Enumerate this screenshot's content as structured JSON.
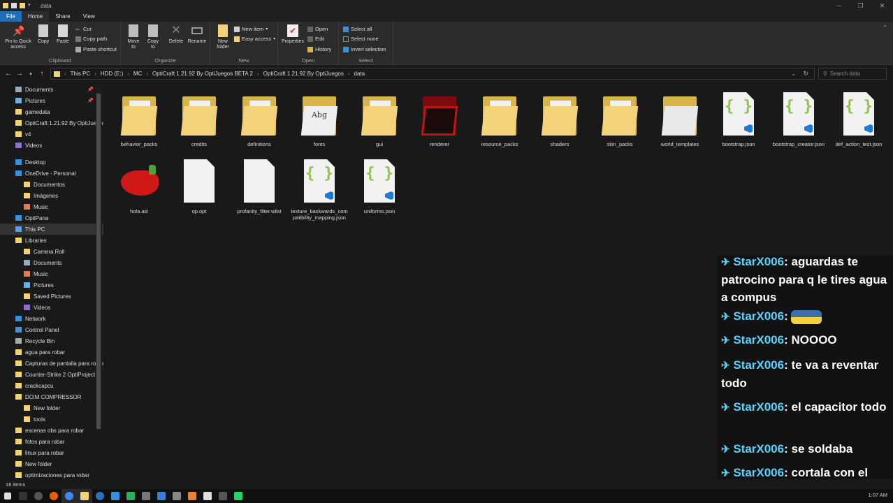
{
  "window": {
    "title": "data"
  },
  "tabs": [
    "File",
    "Home",
    "Share",
    "View"
  ],
  "ribbon": {
    "clipboard": {
      "label": "Clipboard",
      "pin": "Pin to Quick access",
      "copy": "Copy",
      "paste": "Paste",
      "cut": "Cut",
      "copy_path": "Copy path",
      "paste_shortcut": "Paste shortcut"
    },
    "organize": {
      "label": "Organize",
      "move_to": "Move to",
      "copy_to": "Copy to",
      "delete": "Delete",
      "rename": "Rename"
    },
    "new": {
      "label": "New",
      "new_folder": "New folder",
      "new_item": "New item",
      "easy_access": "Easy access"
    },
    "open": {
      "label": "Open",
      "properties": "Properties",
      "open": "Open",
      "edit": "Edit",
      "history": "History"
    },
    "select": {
      "label": "Select",
      "select_all": "Select all",
      "select_none": "Select none",
      "invert": "Invert selection"
    }
  },
  "address": {
    "crumbs": [
      "This PC",
      "HDD (E:)",
      "MC",
      "OptiCraft 1.21.92 By OptiJuegos BETA 2",
      "OptiCraft 1.21.92 By OptiJuegos",
      "data"
    ],
    "search_placeholder": "Search data"
  },
  "sidebar": [
    {
      "label": "Documents",
      "type": "doc",
      "pinned": true
    },
    {
      "label": "Pictures",
      "type": "pic",
      "pinned": true
    },
    {
      "label": "gamedata",
      "type": "folder"
    },
    {
      "label": "OptiCraft 1.21.92 By OptiJuegos",
      "type": "folder"
    },
    {
      "label": "v4",
      "type": "folder"
    },
    {
      "label": "Videos",
      "type": "vid"
    },
    {
      "label": "",
      "type": "gap"
    },
    {
      "label": "Desktop",
      "type": "desk"
    },
    {
      "label": "OneDrive - Personal",
      "type": "cloud"
    },
    {
      "label": "Documentos",
      "type": "folder",
      "indent": 1
    },
    {
      "label": "Imágenes",
      "type": "folder",
      "indent": 1
    },
    {
      "label": "Music",
      "type": "music",
      "indent": 1
    },
    {
      "label": "OptiPana",
      "type": "cloud"
    },
    {
      "label": "This PC",
      "type": "pc",
      "selected": true
    },
    {
      "label": "Libraries",
      "type": "lib"
    },
    {
      "label": "Camera Roll",
      "type": "folder",
      "indent": 1
    },
    {
      "label": "Documents",
      "type": "doc",
      "indent": 1
    },
    {
      "label": "Music",
      "type": "music",
      "indent": 1
    },
    {
      "label": "Pictures",
      "type": "pic",
      "indent": 1
    },
    {
      "label": "Saved Pictures",
      "type": "folder",
      "indent": 1
    },
    {
      "label": "Videos",
      "type": "vid",
      "indent": 1
    },
    {
      "label": "Network",
      "type": "net"
    },
    {
      "label": "Control Panel",
      "type": "cp"
    },
    {
      "label": "Recycle Bin",
      "type": "bin"
    },
    {
      "label": "agua para robar",
      "type": "folder"
    },
    {
      "label": "Capturas de pantalla para robar",
      "type": "folder"
    },
    {
      "label": "Counter-Strike 2 OptiProject",
      "type": "folder"
    },
    {
      "label": "crackcapcu",
      "type": "folder"
    },
    {
      "label": "DCIM COMPRESSOR",
      "type": "folder"
    },
    {
      "label": "New folder",
      "type": "folder",
      "indent": 1
    },
    {
      "label": "tools",
      "type": "folder",
      "indent": 1
    },
    {
      "label": "escenas obs para robar",
      "type": "folder"
    },
    {
      "label": "fotos para robar",
      "type": "folder"
    },
    {
      "label": "linux para robar",
      "type": "folder"
    },
    {
      "label": "New folder",
      "type": "folder"
    },
    {
      "label": "optimizaciones para robar",
      "type": "folder"
    }
  ],
  "files": [
    {
      "name": "behavior_packs",
      "kind": "folder"
    },
    {
      "name": "credits",
      "kind": "folder"
    },
    {
      "name": "definitions",
      "kind": "folder"
    },
    {
      "name": "fonts",
      "kind": "fonts",
      "glyph": "Abg"
    },
    {
      "name": "gui",
      "kind": "folder"
    },
    {
      "name": "renderer",
      "kind": "renderer"
    },
    {
      "name": "resource_packs",
      "kind": "folder"
    },
    {
      "name": "shaders",
      "kind": "folder"
    },
    {
      "name": "skin_packs",
      "kind": "folder"
    },
    {
      "name": "world_templates",
      "kind": "folder-empty"
    },
    {
      "name": "bootstrap.json",
      "kind": "json"
    },
    {
      "name": "bootstrap_creator.json",
      "kind": "json"
    },
    {
      "name": "def_action_test.json",
      "kind": "json"
    },
    {
      "name": "hola.asi",
      "kind": "pepper"
    },
    {
      "name": "op.opt",
      "kind": "blank"
    },
    {
      "name": "profanity_filter.wlist",
      "kind": "blank"
    },
    {
      "name": "texture_backwards_compatibility_mapping.json",
      "kind": "json"
    },
    {
      "name": "uniforms.json",
      "kind": "json"
    }
  ],
  "json_glyph": "{ }",
  "chat": [
    {
      "user": "StarX006",
      "text": "aguardas te patrocino para q le tires agua a compus"
    },
    {
      "user": "StarX006",
      "text": ""
    },
    {
      "user": "StarX006",
      "text": "NOOOO"
    },
    {
      "user": "StarX006",
      "text": "te va a reventar todo"
    },
    {
      "user": "StarX006",
      "text": "el capacitor todo"
    },
    {
      "user": "StarX006",
      "text": "se soldaba"
    },
    {
      "user": "StarX006",
      "text": "cortala con el reflow"
    }
  ],
  "chat_badge": "✈",
  "status": {
    "count": "18 items"
  },
  "taskbar": {
    "clock": "1:07 AM"
  },
  "colors": {
    "accent": "#1f6fb8",
    "chat_user": "#57d3ff",
    "folder": "#f3d37a"
  }
}
